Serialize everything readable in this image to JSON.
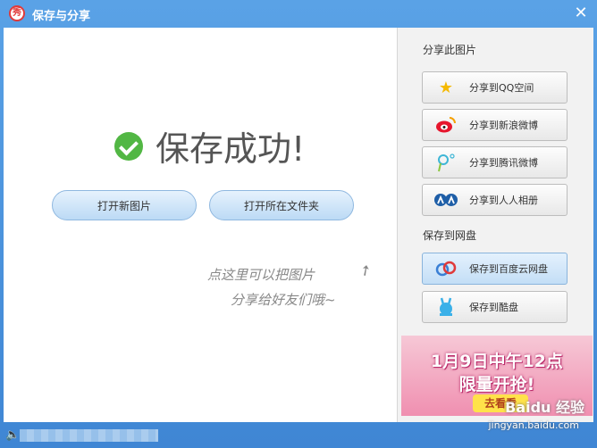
{
  "window": {
    "title": "保存与分享",
    "logo_glyph": "秀",
    "close_glyph": "✕"
  },
  "main": {
    "success_text": "保存成功!",
    "open_new_label": "打开新图片",
    "open_folder_label": "打开所在文件夹",
    "hint_line1": "点这里可以把图片",
    "hint_line2": "分享给好友们哦~"
  },
  "side": {
    "share_section_title": "分享此图片",
    "share_items": [
      {
        "label": "分享到QQ空间",
        "icon": "qzone-star-icon",
        "color": "#f5b900"
      },
      {
        "label": "分享到新浪微博",
        "icon": "sina-weibo-icon",
        "color": "#e6162d"
      },
      {
        "label": "分享到腾讯微博",
        "icon": "tencent-weibo-icon",
        "color": "#3eb6d6"
      },
      {
        "label": "分享到人人相册",
        "icon": "renren-icon",
        "color": "#1e5ea7"
      }
    ],
    "cloud_section_title": "保存到网盘",
    "cloud_items": [
      {
        "label": "保存到百度云网盘",
        "icon": "baidu-cloud-icon",
        "color": "#3a7fd5"
      },
      {
        "label": "保存到酷盘",
        "icon": "kupan-icon",
        "color": "#3ab0e8"
      }
    ]
  },
  "banner": {
    "line1": "1月9日中午12点",
    "line2": "限量开抢!",
    "button_label": "去看看"
  },
  "watermark": {
    "text": "Baidu 经验",
    "url": "jingyan.baidu.com"
  },
  "statusbar": {
    "volume_glyph": "🔈"
  }
}
